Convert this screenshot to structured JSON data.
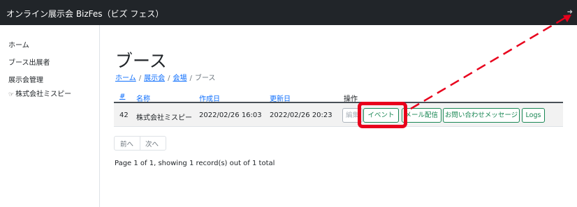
{
  "header": {
    "title": "オンライン展示会 BizFes（ビズ フェス）",
    "logout_icon": "➜"
  },
  "sidebar": {
    "items": [
      {
        "label": "ホーム"
      },
      {
        "label": "ブース出展者"
      },
      {
        "label": "展示会管理"
      },
      {
        "label": "株式会社ミスピー",
        "icon": "pointing-hand-icon"
      }
    ]
  },
  "page": {
    "title": "ブース",
    "breadcrumb": [
      "ホーム",
      "展示会",
      "会場",
      "ブース"
    ]
  },
  "table": {
    "headers": {
      "id": "#",
      "name": "名称",
      "created": "作成日",
      "updated": "更新日",
      "actions": "操作"
    },
    "rows": [
      {
        "id": "42",
        "name": "株式会社ミスピー",
        "created": "2022/02/26 16:03",
        "updated": "2022/02/26 20:23",
        "actions": [
          "編集",
          "イベント",
          "メール配信",
          "お問い合わせメッセージ",
          "Logs"
        ]
      }
    ]
  },
  "pagination": {
    "prev": "前へ",
    "next": "次へ",
    "summary": "Page 1 of 1, showing 1 record(s) out of 1 total"
  },
  "annotation": {
    "color": "#e8001c"
  }
}
